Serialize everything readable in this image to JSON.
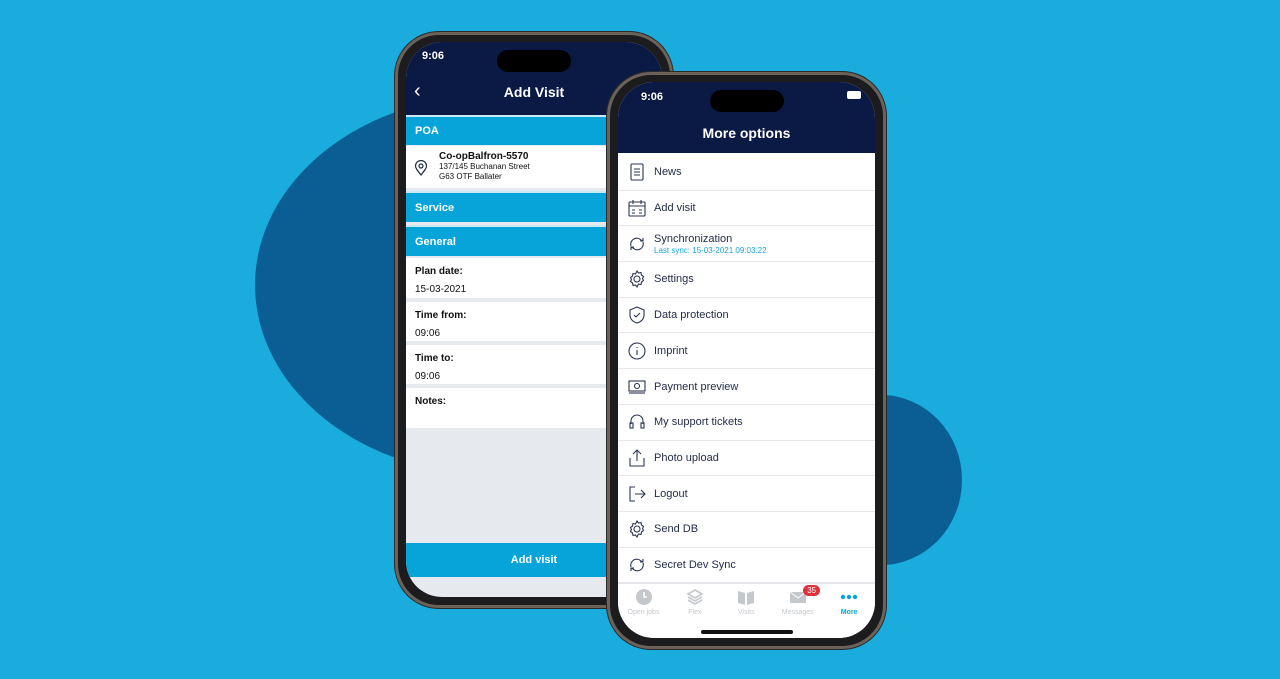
{
  "colors": {
    "background": "#19acdc",
    "blob": "#0b5e93",
    "navy": "#0b1a45",
    "accent": "#07a4d9",
    "badge": "#e0323c"
  },
  "left_phone": {
    "status_time": "9:06",
    "title": "Add Visit",
    "sections": {
      "poa": "POA",
      "service": "Service",
      "general": "General"
    },
    "location": {
      "name": "Co-opBalfron-5570",
      "street": "137/145 Buchanan Street",
      "city": "G63 OTF Ballater"
    },
    "fields": [
      {
        "label": "Plan date:",
        "value": "15-03-2021"
      },
      {
        "label": "Time from:",
        "value": "09:06"
      },
      {
        "label": "Time to:",
        "value": "09:06"
      },
      {
        "label": "Notes:",
        "value": ""
      }
    ],
    "add_button": "Add visit"
  },
  "right_phone": {
    "status_time": "9:06",
    "title": "More options",
    "items": [
      {
        "label": "News",
        "icon": "document-icon"
      },
      {
        "label": "Add visit",
        "icon": "calendar-icon"
      },
      {
        "label": "Synchronization",
        "icon": "sync-icon",
        "sub": "Last sync: 15-03-2021 09:03:22"
      },
      {
        "label": "Settings",
        "icon": "gear-icon"
      },
      {
        "label": "Data protection",
        "icon": "shield-icon"
      },
      {
        "label": "Imprint",
        "icon": "info-icon"
      },
      {
        "label": "Payment preview",
        "icon": "banknote-icon"
      },
      {
        "label": "My support tickets",
        "icon": "headset-icon"
      },
      {
        "label": "Photo upload",
        "icon": "upload-icon"
      },
      {
        "label": "Logout",
        "icon": "logout-icon"
      },
      {
        "label": "Send DB",
        "icon": "gear-icon"
      },
      {
        "label": "Secret Dev Sync",
        "icon": "sync-icon"
      }
    ],
    "tabs": [
      {
        "label": "Open jobs",
        "icon": "clock-icon"
      },
      {
        "label": "Flex",
        "icon": "layers-icon"
      },
      {
        "label": "Visits",
        "icon": "book-icon"
      },
      {
        "label": "Messages",
        "icon": "mail-icon",
        "badge": "35"
      },
      {
        "label": "More",
        "icon": "more-icon",
        "active": true
      }
    ]
  }
}
